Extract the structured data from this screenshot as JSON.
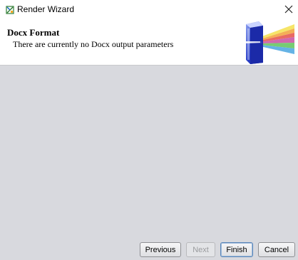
{
  "window": {
    "title": "Render Wizard",
    "app_icon": "render-app-icon",
    "close_icon": "close-icon"
  },
  "header": {
    "heading": "Docx Format",
    "description": "There are currently no Docx output parameters",
    "logo_icon": "render-prism-logo-icon"
  },
  "buttons": {
    "previous": "Previous",
    "next": "Next",
    "finish": "Finish",
    "cancel": "Cancel"
  },
  "states": {
    "next_enabled": false,
    "finish_default": true
  },
  "colors": {
    "content_background": "#d8d9de",
    "header_background": "#ffffff",
    "disabled_text": "#9a9b9e",
    "default_button_border": "#5a86b8"
  }
}
